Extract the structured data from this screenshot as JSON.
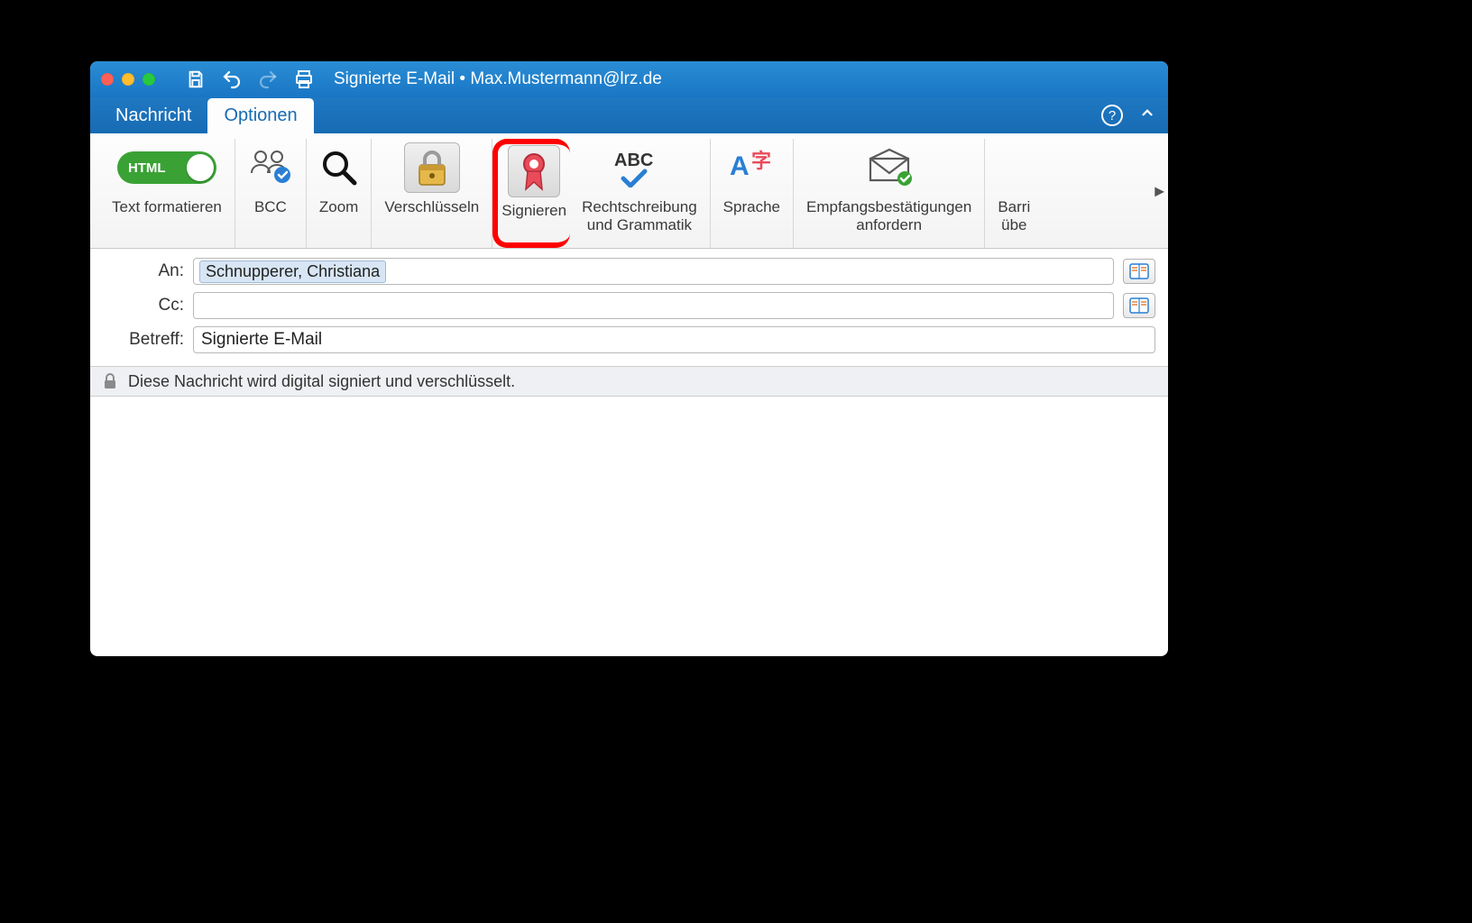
{
  "window": {
    "title": "Signierte E-Mail • Max.Mustermann@lrz.de"
  },
  "tabs": {
    "message": "Nachricht",
    "options": "Optionen"
  },
  "ribbon": {
    "html_toggle": "HTML",
    "text_format": "Text formatieren",
    "bcc": "BCC",
    "zoom": "Zoom",
    "encrypt": "Verschlüsseln",
    "sign": "Signieren",
    "spelling": "Rechtschreibung\nund Grammatik",
    "language": "Sprache",
    "receipts": "Empfangsbestätigungen\nanfordern",
    "accessibility": "Barri\nübe"
  },
  "fields": {
    "to_label": "An:",
    "to_value": "Schnupperer, Christiana",
    "cc_label": "Cc:",
    "cc_value": "",
    "subject_label": "Betreff:",
    "subject_value": "Signierte E-Mail"
  },
  "banner": {
    "text": "Diese Nachricht wird digital signiert und verschlüsselt."
  }
}
